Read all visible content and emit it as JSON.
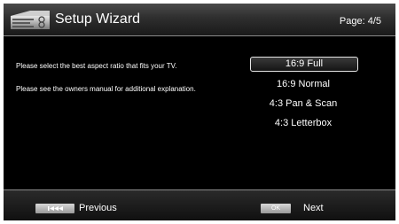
{
  "header": {
    "title": "Setup Wizard",
    "page_indicator": "Page: 4/5",
    "logo_icon": "tv-setup-icon"
  },
  "main": {
    "instruction_1": "Please select the best aspect ratio that fits your TV.",
    "instruction_2": "Please see the owners manual for additional explanation.",
    "options": [
      {
        "label": "16:9 Full",
        "selected": true
      },
      {
        "label": "16:9 Normal",
        "selected": false
      },
      {
        "label": "4:3 Pan & Scan",
        "selected": false
      },
      {
        "label": "4:3 Letterbox",
        "selected": false
      }
    ]
  },
  "footer": {
    "previous_label": "Previous",
    "previous_key_icon": "skip-back-icon",
    "next_label": "Next",
    "next_key_label": "OK"
  },
  "colors": {
    "background": "#000000",
    "text": "#ffffff",
    "key_button": "#b0b0b0"
  }
}
